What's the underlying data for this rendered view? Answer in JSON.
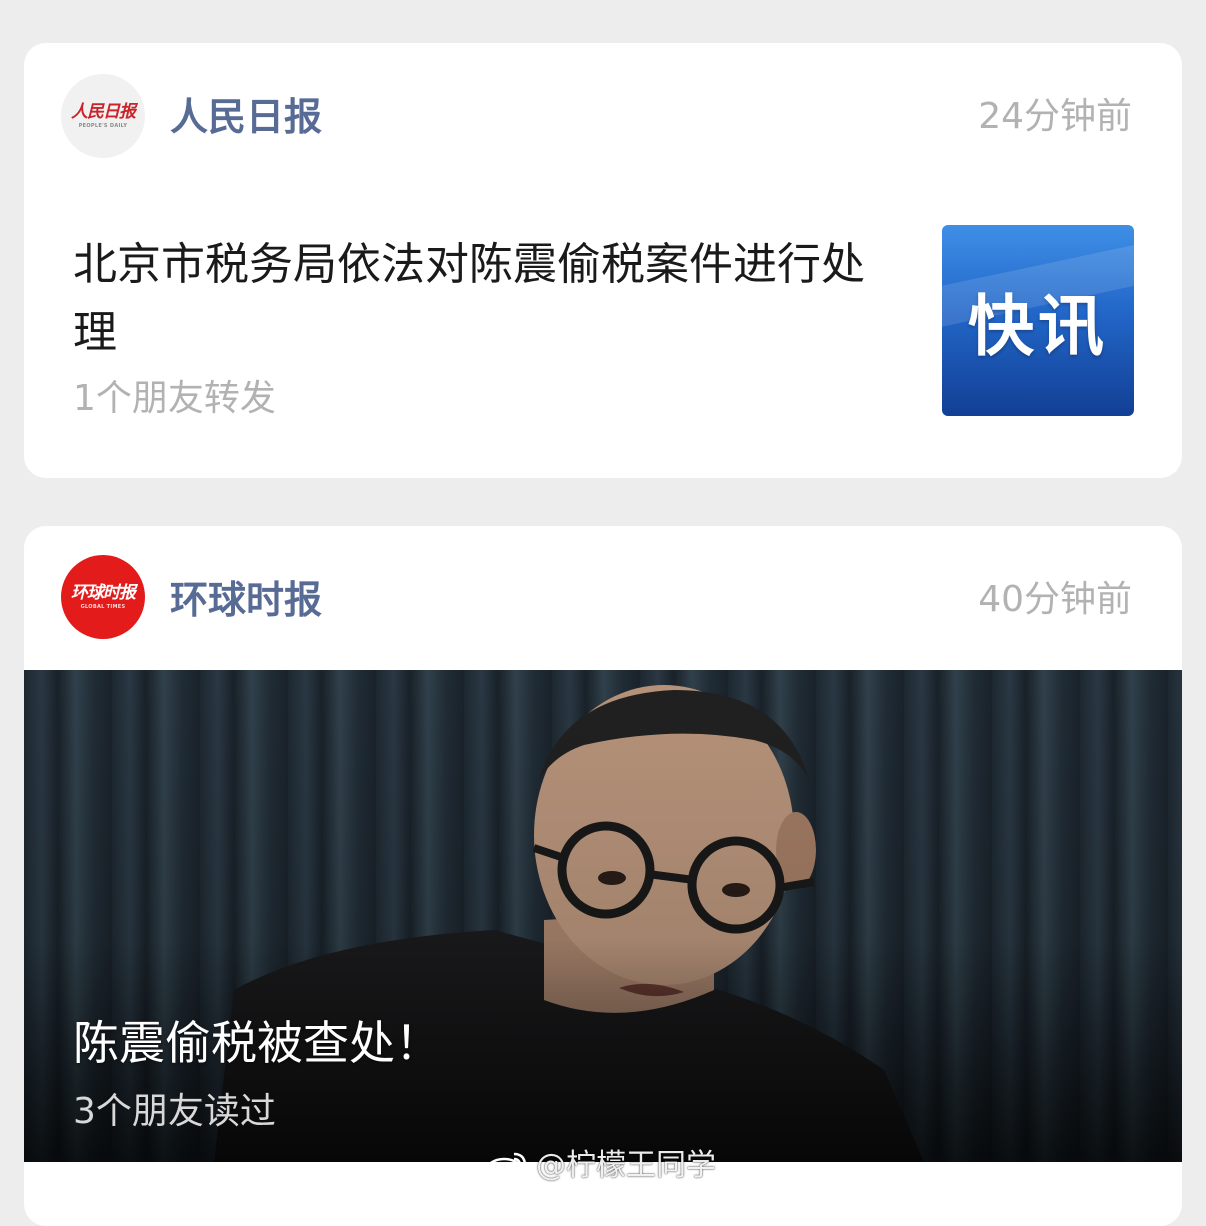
{
  "cards": [
    {
      "source": "人民日报",
      "time": "24分钟前",
      "logo": {
        "main": "人民日报",
        "sub": "PEOPLE'S DAILY"
      },
      "headline": "北京市税务局依法对陈震偷税案件进行处理",
      "meta": "1个朋友转发",
      "thumbnail_text": "快讯"
    },
    {
      "source": "环球时报",
      "time": "40分钟前",
      "logo": {
        "main": "环球时报",
        "sub": "GLOBAL TIMES"
      },
      "headline": "陈震偷税被查处！",
      "meta": "3个朋友读过"
    }
  ],
  "watermark": {
    "text": "@柠檬王同学",
    "icon": "weibo-icon"
  },
  "colors": {
    "source_link": "#576b95",
    "muted": "#b2b2b2",
    "background": "#ededed",
    "logo_red": "#e31b1b"
  }
}
